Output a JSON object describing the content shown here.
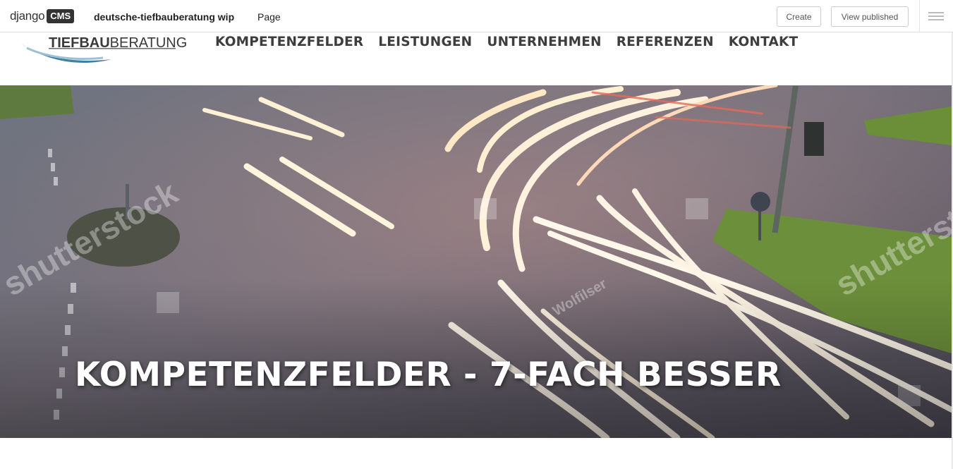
{
  "cms_toolbar": {
    "logo_text": "django",
    "logo_badge": "CMS",
    "site_name": "deutsche-tiefbauberatung wip",
    "page_menu": "Page",
    "create_label": "Create",
    "view_published_label": "View published"
  },
  "site": {
    "logo": {
      "part1": "TIEFBAU",
      "part2": "BERATUNG"
    },
    "nav": [
      {
        "label": "KOMPETENZFELDER"
      },
      {
        "label": "LEISTUNGEN"
      },
      {
        "label": "UNTERNEHMEN"
      },
      {
        "label": "REFERENZEN"
      },
      {
        "label": "KONTAKT"
      }
    ]
  },
  "hero": {
    "title": "KOMPETENZFELDER - 7-FACH BESSER",
    "watermarks": [
      "shutterstock",
      "Wolfilser"
    ]
  }
}
